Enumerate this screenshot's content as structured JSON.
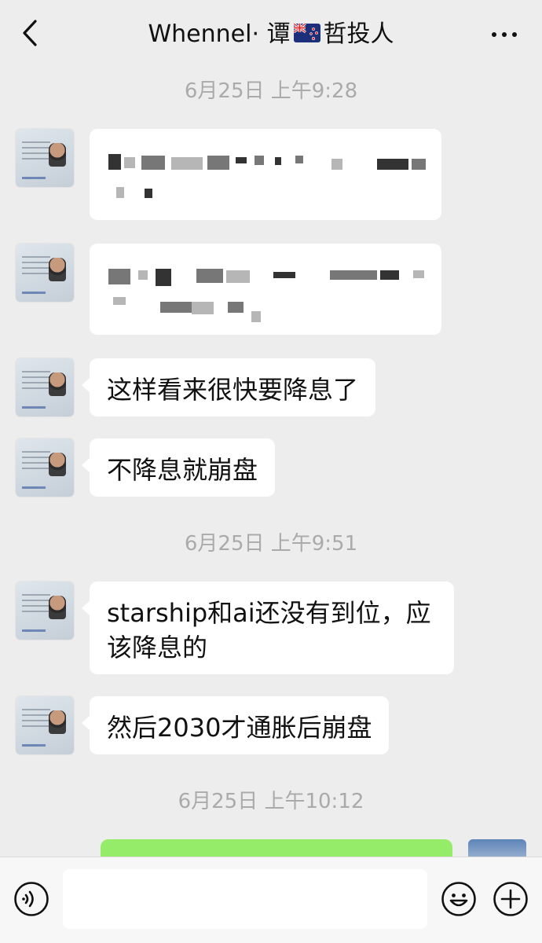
{
  "header": {
    "title_prefix": "Whennel· 谭",
    "title_suffix": "哲投人",
    "flag_icon": "new-zealand-flag-icon",
    "back_icon": "chevron-left-icon",
    "more_icon": "more-dots-icon"
  },
  "timestamps": [
    "6月25日 上午9:28",
    "6月25日 上午9:51",
    "6月25日 上午10:12"
  ],
  "messages": [
    {
      "text": "",
      "redacted": true
    },
    {
      "text": "",
      "redacted": true
    },
    {
      "text": "这样看来很快要降息了"
    },
    {
      "text": "不降息就崩盘"
    },
    {
      "text": "starship和ai还没有到位，应该降息的"
    },
    {
      "text": "然后2030才通胀后崩盘"
    }
  ],
  "input_bar": {
    "voice_icon": "voice-icon",
    "emoji_icon": "emoji-icon",
    "plus_icon": "plus-circle-icon",
    "placeholder": ""
  },
  "colors": {
    "background": "#ededed",
    "incoming_bubble": "#ffffff",
    "outgoing_bubble": "#95ec69",
    "timestamp_text": "#aaaaaa"
  }
}
